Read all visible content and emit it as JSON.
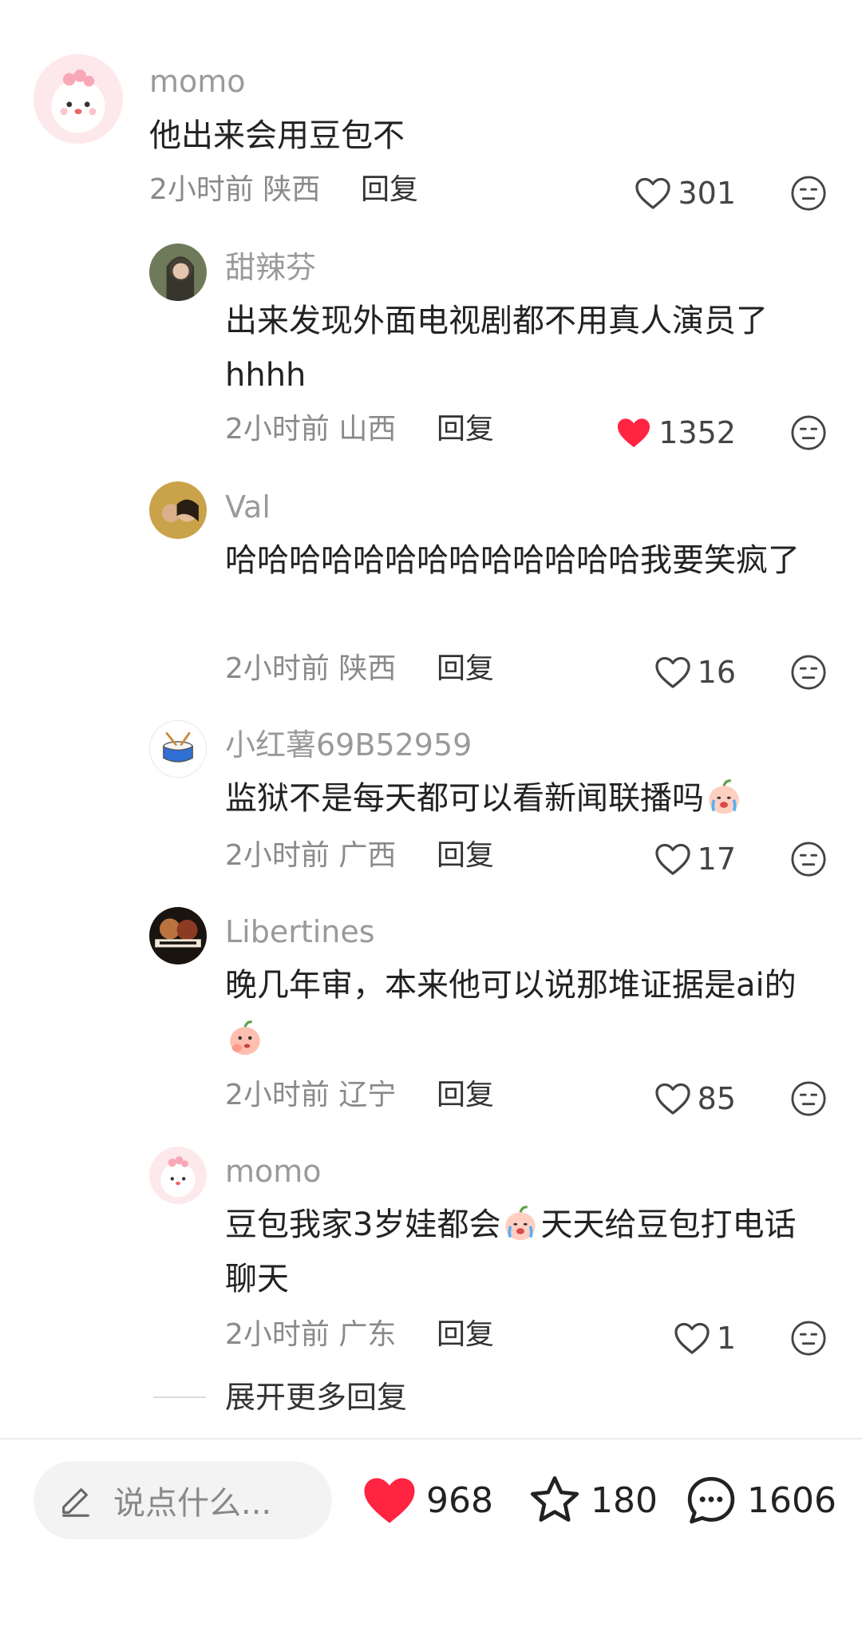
{
  "comments": [
    {
      "user": "momo",
      "text": "他出来会用豆包不",
      "time": "2小时前",
      "region": "陕西",
      "reply": "回复",
      "likes": "301",
      "liked": false
    },
    {
      "user": "甜辣芬",
      "text": "出来发现外面电视剧都不用真人演员了hhhh",
      "time": "2小时前",
      "region": "山西",
      "reply": "回复",
      "likes": "1352",
      "liked": true
    },
    {
      "user": "Val",
      "text": "哈哈哈哈哈哈哈哈哈哈哈哈哈我要笑疯了",
      "time": "2小时前",
      "region": "陕西",
      "reply": "回复",
      "likes": "16",
      "liked": false
    },
    {
      "user": "小红薯69B52959",
      "text": "监狱不是每天都可以看新闻联播吗",
      "time": "2小时前",
      "region": "广西",
      "reply": "回复",
      "likes": "17",
      "liked": false,
      "emoji": "crying-peach-emoji"
    },
    {
      "user": "Libertines",
      "text": "晚几年审，本来他可以说那堆证据是ai的",
      "time": "2小时前",
      "region": "辽宁",
      "reply": "回复",
      "likes": "85",
      "liked": false,
      "emoji": "peach-thinking-emoji"
    },
    {
      "user": "momo",
      "text_a": "豆包我家3岁娃都会",
      "text_b": "天天给豆包打电话聊天",
      "time": "2小时前",
      "region": "广东",
      "reply": "回复",
      "likes": "1",
      "liked": false,
      "emoji": "crying-peach-emoji"
    }
  ],
  "expand_more": "展开更多回复",
  "bottom": {
    "input_placeholder": "说点什么...",
    "likes": "968",
    "favorites": "180",
    "comments": "1606"
  },
  "colors": {
    "liked_heart": "#ff2442",
    "muted_text": "#8a8a8a",
    "username": "#9a9a9a"
  }
}
